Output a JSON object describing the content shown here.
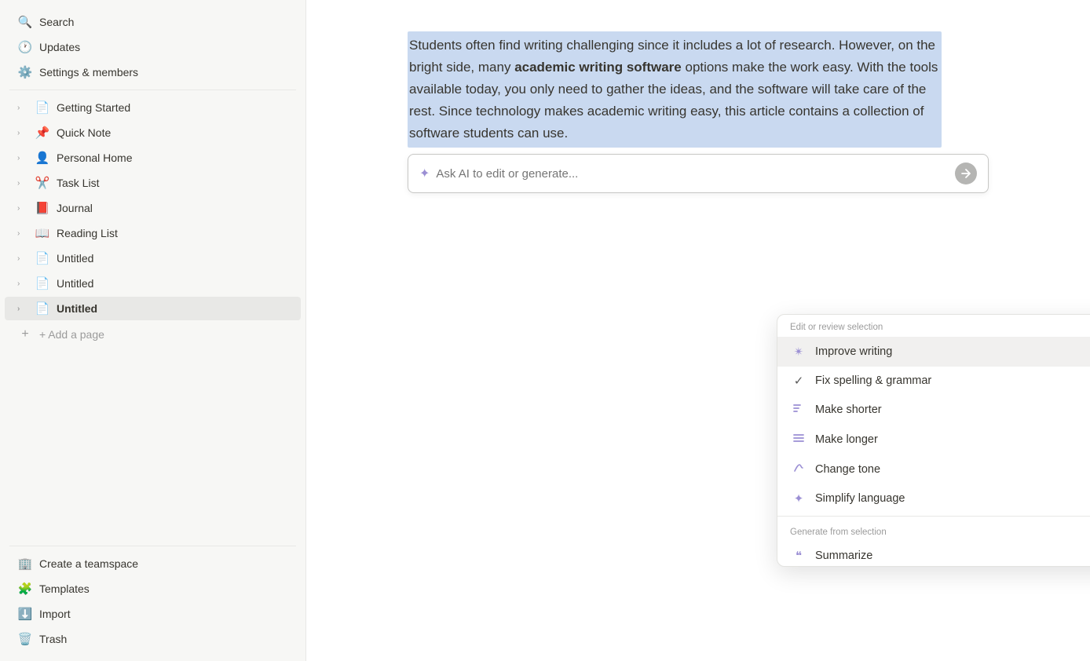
{
  "sidebar": {
    "items_top": [
      {
        "id": "search",
        "label": "Search",
        "icon": "🔍",
        "chevron": false,
        "active": false
      },
      {
        "id": "updates",
        "label": "Updates",
        "icon": "🕐",
        "chevron": false,
        "active": false
      },
      {
        "id": "settings",
        "label": "Settings & members",
        "icon": "⚙️",
        "chevron": false,
        "active": false
      }
    ],
    "items_pages": [
      {
        "id": "getting-started",
        "label": "Getting Started",
        "icon": "📄",
        "chevron": "›",
        "active": false
      },
      {
        "id": "quick-note",
        "label": "Quick Note",
        "icon": "📌",
        "chevron": "›",
        "active": false
      },
      {
        "id": "personal-home",
        "label": "Personal Home",
        "icon": "👤",
        "chevron": "›",
        "active": false
      },
      {
        "id": "task-list",
        "label": "Task List",
        "icon": "✂️",
        "chevron": "›",
        "active": false
      },
      {
        "id": "journal",
        "label": "Journal",
        "icon": "📕",
        "chevron": "›",
        "active": false
      },
      {
        "id": "reading-list",
        "label": "Reading List",
        "icon": "📖",
        "chevron": "›",
        "active": false
      },
      {
        "id": "untitled-1",
        "label": "Untitled",
        "icon": "📄",
        "chevron": "›",
        "active": false
      },
      {
        "id": "untitled-2",
        "label": "Untitled",
        "icon": "📄",
        "chevron": "›",
        "active": false
      },
      {
        "id": "untitled-3",
        "label": "Untitled",
        "icon": "📄",
        "chevron": "›",
        "active": true
      }
    ],
    "add_page_label": "+ Add a page",
    "items_bottom": [
      {
        "id": "create-teamspace",
        "label": "Create a teamspace",
        "icon": "🏢",
        "chevron": false
      },
      {
        "id": "templates",
        "label": "Templates",
        "icon": "🧩",
        "chevron": false
      },
      {
        "id": "import",
        "label": "Import",
        "icon": "⬇️",
        "chevron": false
      },
      {
        "id": "trash",
        "label": "Trash",
        "icon": "🗑️",
        "chevron": false
      }
    ]
  },
  "editor": {
    "selected_text": "Students often find writing challenging since it includes a lot of research. However, on the bright side, many ",
    "selected_text_bold": "academic writing software",
    "selected_text_end": " options make the work easy. With the tools available today, you only need to gather the ideas, and the software will take care of the rest. Since technology makes academic writing easy, this article contains a collection of software students can use."
  },
  "ai_bar": {
    "placeholder": "Ask AI to edit or generate..."
  },
  "ai_dropdown": {
    "section1_label": "Edit or review selection",
    "items_section1": [
      {
        "id": "improve-writing",
        "label": "Improve writing",
        "icon_type": "sparkle",
        "shortcut": "↵",
        "arrow": false,
        "highlighted": true
      },
      {
        "id": "fix-spelling",
        "label": "Fix spelling & grammar",
        "icon_type": "check",
        "shortcut": null,
        "arrow": false,
        "highlighted": false
      },
      {
        "id": "make-shorter",
        "label": "Make shorter",
        "icon_type": "lines-short",
        "shortcut": null,
        "arrow": false,
        "highlighted": false
      },
      {
        "id": "make-longer",
        "label": "Make longer",
        "icon_type": "lines-long",
        "shortcut": null,
        "arrow": false,
        "highlighted": false
      },
      {
        "id": "change-tone",
        "label": "Change tone",
        "icon_type": "tone",
        "shortcut": null,
        "arrow": true,
        "highlighted": false
      },
      {
        "id": "simplify",
        "label": "Simplify language",
        "icon_type": "sparkle4",
        "shortcut": null,
        "arrow": false,
        "highlighted": false
      }
    ],
    "section2_label": "Generate from selection",
    "items_section2": [
      {
        "id": "summarize",
        "label": "Summarize",
        "icon_type": "quote",
        "shortcut": null,
        "arrow": false,
        "highlighted": false
      }
    ]
  }
}
